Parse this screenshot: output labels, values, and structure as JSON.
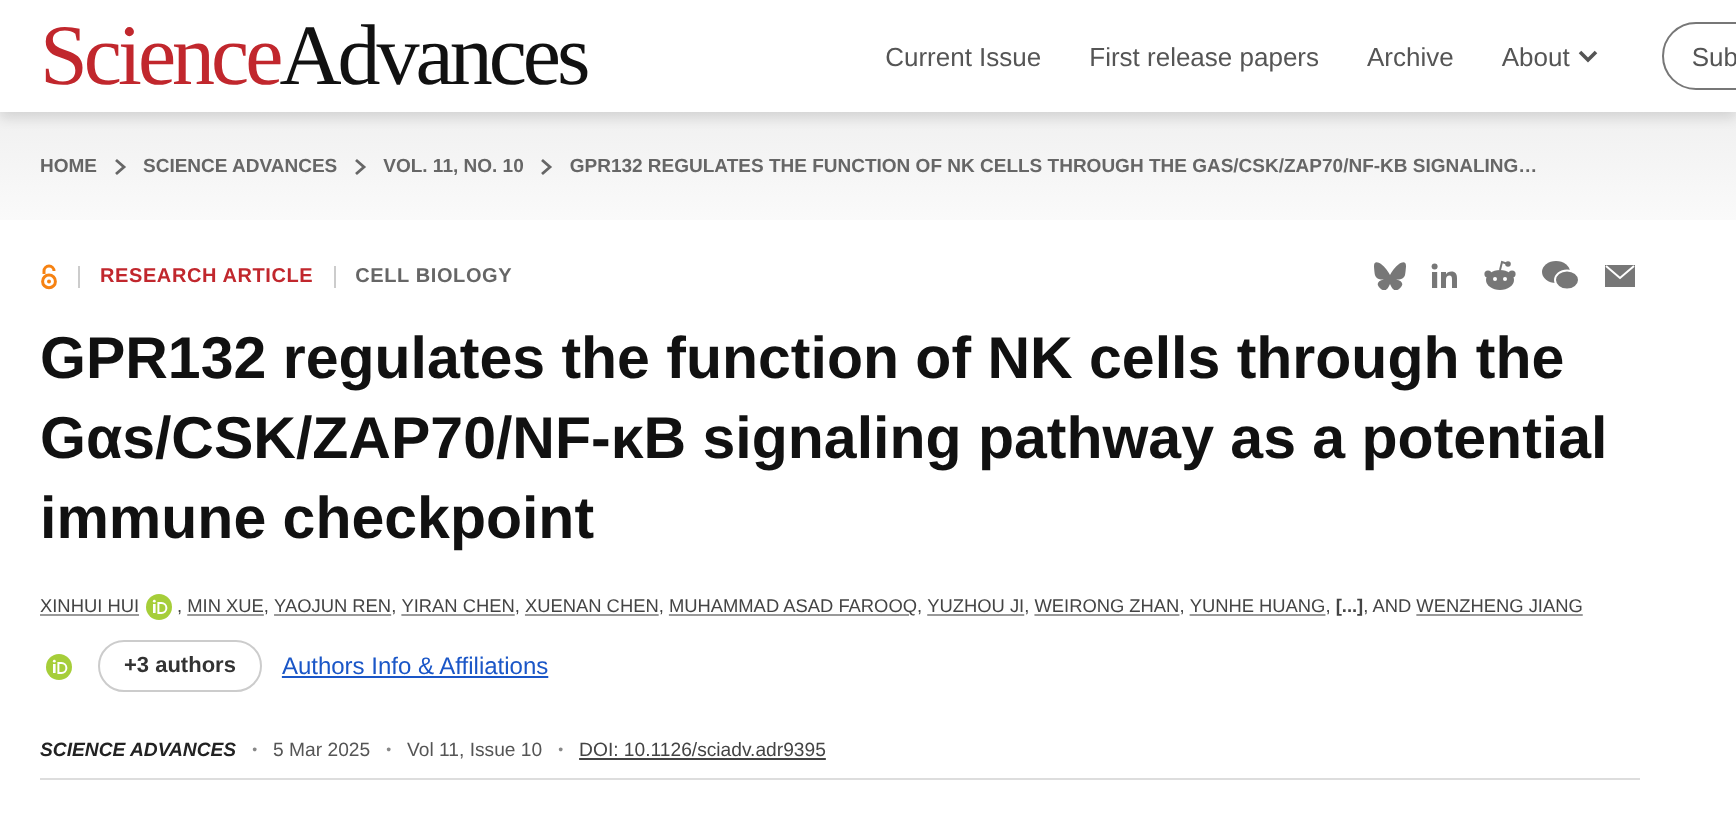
{
  "logo": {
    "first": "Science",
    "second": "Advances"
  },
  "nav": {
    "items": [
      {
        "label": "Current Issue",
        "dropdown": false
      },
      {
        "label": "First release papers",
        "dropdown": false
      },
      {
        "label": "Archive",
        "dropdown": false
      },
      {
        "label": "About",
        "dropdown": true
      }
    ],
    "button": "Sub"
  },
  "breadcrumb": [
    "HOME",
    "SCIENCE ADVANCES",
    "VOL. 11, NO. 10",
    "GPR132 REGULATES THE FUNCTION OF NK CELLS THROUGH THE GAS/CSK/ZAP70/NF-KB SIGNALING…"
  ],
  "article": {
    "open_access": true,
    "type": "RESEARCH ARTICLE",
    "subject": "CELL BIOLOGY",
    "share": [
      {
        "kind": "bluesky"
      },
      {
        "kind": "linkedin"
      },
      {
        "kind": "reddit"
      },
      {
        "kind": "wechat"
      },
      {
        "kind": "email"
      }
    ],
    "comma": ",",
    "title": "GPR132 regulates the function of NK cells through the Gαs/CSK/ZAP70/NF-κB signaling pathway as a potential immune checkpoint",
    "authors": [
      {
        "name": "XINHUI HUI",
        "orcid": true
      },
      {
        "name": "MIN XUE",
        "orcid": false
      },
      {
        "name": "YAOJUN REN",
        "orcid": false
      },
      {
        "name": "YIRAN CHEN",
        "orcid": false
      },
      {
        "name": "XUENAN CHEN",
        "orcid": false
      },
      {
        "name": "MUHAMMAD ASAD FAROOQ",
        "orcid": false
      },
      {
        "name": "YUZHOU JI",
        "orcid": false
      },
      {
        "name": "WEIRONG ZHAN",
        "orcid": false
      },
      {
        "name": "YUNHE HUANG",
        "orcid": false
      }
    ],
    "ellipsis": "[...]",
    "last_prefix": ", AND",
    "last_author": {
      "name": "WENZHENG JIANG",
      "orcid": true
    },
    "more_button": "+3 authors",
    "affiliations_link": "Authors Info & Affiliations",
    "journal": "SCIENCE ADVANCES",
    "date": "5 Mar 2025",
    "issue": "Vol 11, Issue 10",
    "doi": "DOI: 10.1126/sciadv.adr9395",
    "separator": "•"
  }
}
